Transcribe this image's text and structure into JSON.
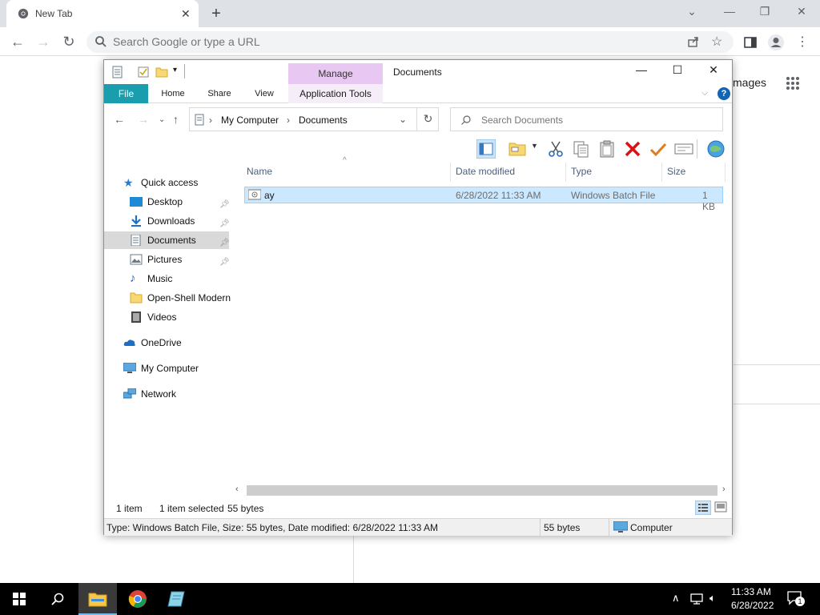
{
  "chrome": {
    "tab_title": "New Tab",
    "omnibox_placeholder": "Search Google or type a URL",
    "bg_images_label": "mages"
  },
  "explorer": {
    "title": "Documents",
    "manage_label": "Manage",
    "ribbon_tabs": {
      "file": "File",
      "home": "Home",
      "share": "Share",
      "view": "View",
      "application_tools": "Application Tools"
    },
    "help_label": "?",
    "breadcrumb": [
      "My Computer",
      "Documents"
    ],
    "search_placeholder": "Search Documents",
    "nav": {
      "quick_access": "Quick access",
      "desktop": "Desktop",
      "downloads": "Downloads",
      "documents": "Documents",
      "pictures": "Pictures",
      "music": "Music",
      "open_shell": "Open-Shell Modern",
      "videos": "Videos",
      "onedrive": "OneDrive",
      "my_computer": "My Computer",
      "network": "Network"
    },
    "columns": {
      "name": "Name",
      "date_modified": "Date modified",
      "type": "Type",
      "size": "Size"
    },
    "files": [
      {
        "name": "ay",
        "date_modified": "6/28/2022 11:33 AM",
        "type": "Windows Batch File",
        "size": "1 KB"
      }
    ],
    "status": {
      "item_count": "1 item",
      "selected": "1 item selected",
      "selected_size": "55 bytes",
      "details": "Type: Windows Batch File, Size: 55 bytes, Date modified: 6/28/2022 11:33 AM",
      "size": "55 bytes",
      "location": "Computer"
    }
  },
  "taskbar": {
    "time": "11:33 AM",
    "date": "6/28/2022",
    "notification_count": "1"
  },
  "colors": {
    "chrome_tabstrip": "#dee1e6",
    "file_tab": "#1a9eae",
    "manage_tab": "#e8c8f2",
    "selection": "#cce8ff",
    "taskbar": "#000000"
  }
}
